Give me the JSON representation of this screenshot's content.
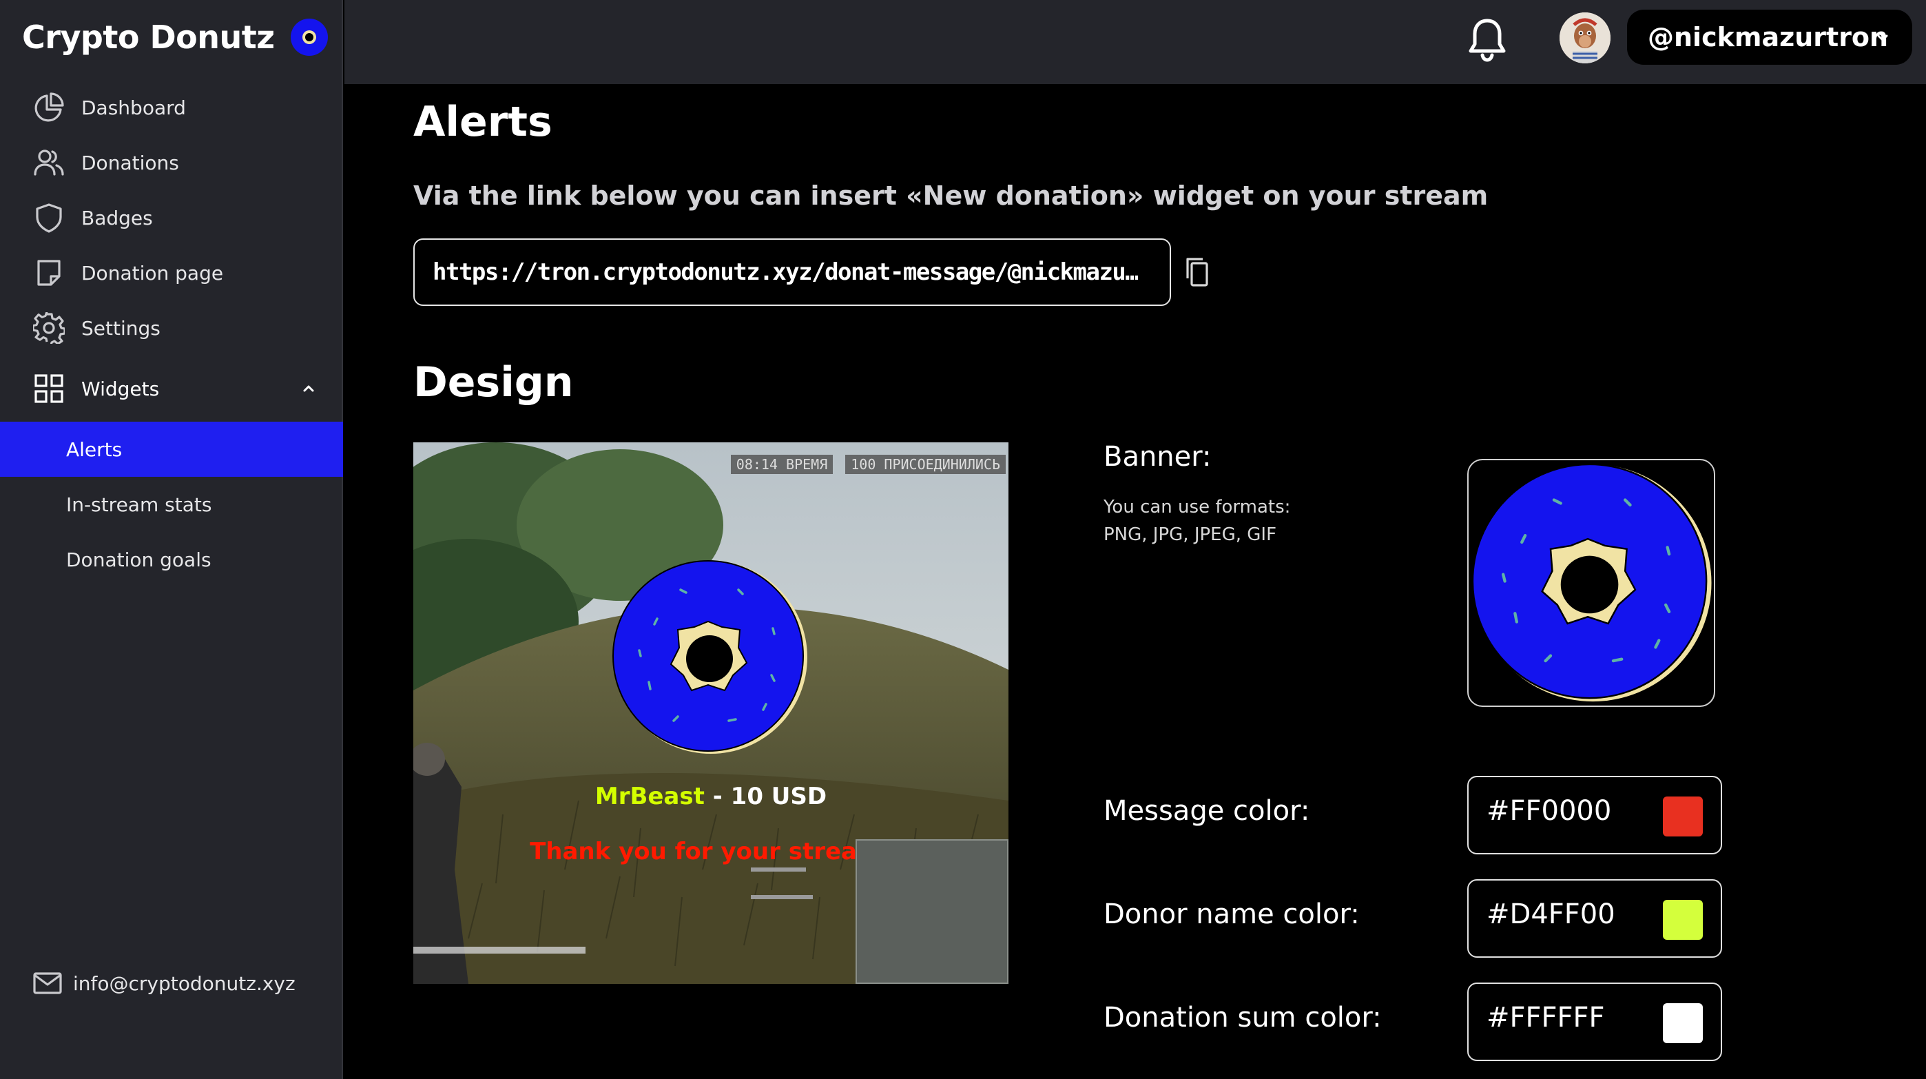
{
  "brand": {
    "title": "Crypto Donutz"
  },
  "sidebar": {
    "items": [
      {
        "label": "Dashboard",
        "icon": "pie-chart-icon"
      },
      {
        "label": "Donations",
        "icon": "users-icon"
      },
      {
        "label": "Badges",
        "icon": "shield-icon"
      },
      {
        "label": "Donation page",
        "icon": "sticky-note-icon"
      },
      {
        "label": "Settings",
        "icon": "gear-icon"
      },
      {
        "label": "Widgets",
        "icon": "grid-icon",
        "expanded": true
      }
    ],
    "sub_items": [
      {
        "label": "Alerts",
        "active": true
      },
      {
        "label": "In-stream stats",
        "active": false
      },
      {
        "label": "Donation goals",
        "active": false
      }
    ],
    "footer_email": "info@cryptodonutz.xyz"
  },
  "topbar": {
    "username": "@nickmazurtron"
  },
  "main": {
    "title": "Alerts",
    "subtitle": "Via the link below you can insert «New donation» widget on your stream",
    "widget_link": "https://tron.cryptodonutz.xyz/donat-message/@nickmazu…",
    "design_title": "Design"
  },
  "preview": {
    "hud_time": "08:14 ВРЕМЯ",
    "hud_joined": "100 ПРИСОЕДИНИЛИСЬ",
    "donor_name": "MrBeast",
    "sum_text": " - 10 USD",
    "message": "Thank you for your stream!"
  },
  "settings": {
    "banner_label": "Banner:",
    "formats_line1": "You can use formats:",
    "formats_line2": "PNG, JPG, JPEG, GIF",
    "message_color_label": "Message color:",
    "message_color": "#FF0000",
    "donor_color_label": "Donor name color:",
    "donor_color": "#D4FF00",
    "sum_color_label": "Donation sum color:",
    "sum_color": "#FFFFFF"
  },
  "colors": {
    "accent": "#1f1ff0",
    "sidebar_bg": "#24252b",
    "donut_blue": "#1414ee",
    "donut_cream": "#f1e3a4"
  }
}
